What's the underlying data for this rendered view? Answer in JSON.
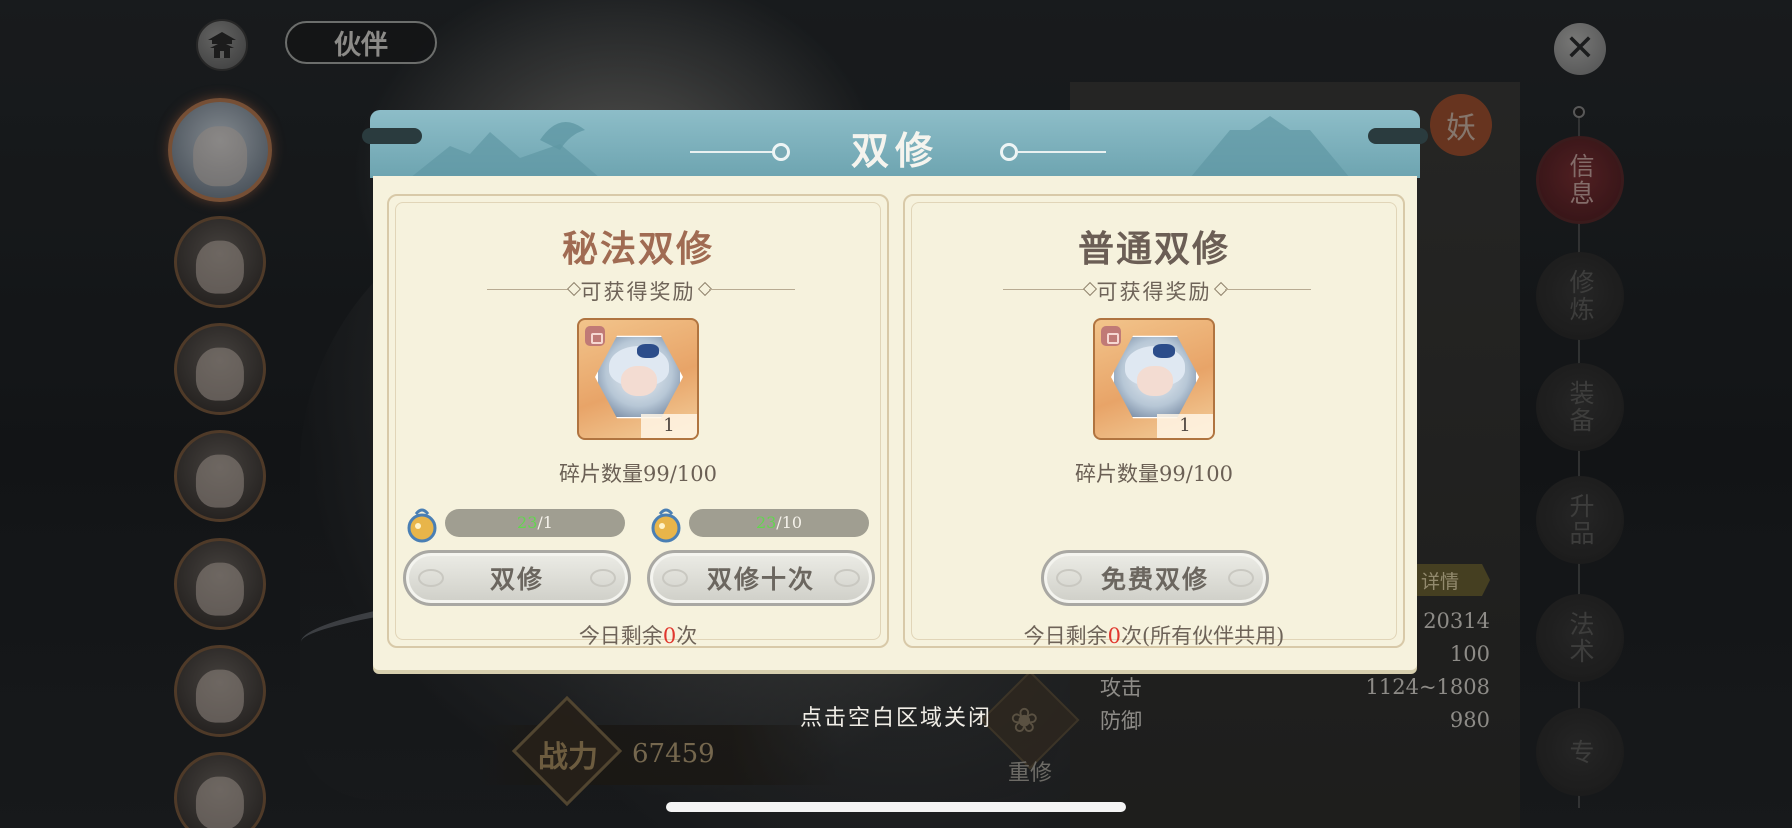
{
  "header": {
    "title": "伙伴"
  },
  "partners": [
    {
      "name": "partner-1",
      "active": true
    },
    {
      "name": "partner-2",
      "active": false
    },
    {
      "name": "partner-3",
      "active": false
    },
    {
      "name": "partner-4",
      "active": false
    },
    {
      "name": "partner-5",
      "active": false
    },
    {
      "name": "partner-6",
      "active": false
    },
    {
      "name": "partner-7",
      "active": false
    }
  ],
  "side_tabs": [
    {
      "label": "信息",
      "active": true
    },
    {
      "label": "修炼",
      "active": false
    },
    {
      "label": "装备",
      "active": false
    },
    {
      "label": "升品",
      "active": false
    },
    {
      "label": "法术",
      "active": false
    },
    {
      "label": "专",
      "active": false
    }
  ],
  "info_panel": {
    "seal": "妖",
    "detail_tag": "详情",
    "stats": [
      {
        "label": "",
        "value": "20314"
      },
      {
        "label": "",
        "value": "100"
      },
      {
        "label": "攻击",
        "value": "1124~1808"
      },
      {
        "label": "防御",
        "value": "980"
      }
    ]
  },
  "power": {
    "label": "战力",
    "value": "67459"
  },
  "rebuild": {
    "label": "重修"
  },
  "close_hint": "点击空白区域关闭",
  "dialog": {
    "title": "双修",
    "secret": {
      "title": "秘法双修",
      "reward_label": "可获得奖励",
      "item_count": "1",
      "fragments": "碎片数量99/100",
      "costs": [
        {
          "have": "23",
          "need": "/1"
        },
        {
          "have": "23",
          "need": "/10"
        }
      ],
      "btn_once": "双修",
      "btn_ten": "双修十次",
      "remain_prefix": "今日剩余",
      "remain_count": "0",
      "remain_suffix": "次"
    },
    "normal": {
      "title": "普通双修",
      "reward_label": "可获得奖励",
      "item_count": "1",
      "fragments": "碎片数量99/100",
      "btn_free": "免费双修",
      "remain_prefix": "今日剩余",
      "remain_count": "0",
      "remain_suffix": "次(所有伙伴共用)"
    }
  },
  "colors": {
    "dialog_header": "#7fb2bd",
    "dialog_body": "#f6f2dd",
    "secret_title": "#a06b52",
    "have_count": "#63d64f",
    "remain_zero": "#e0372e"
  }
}
